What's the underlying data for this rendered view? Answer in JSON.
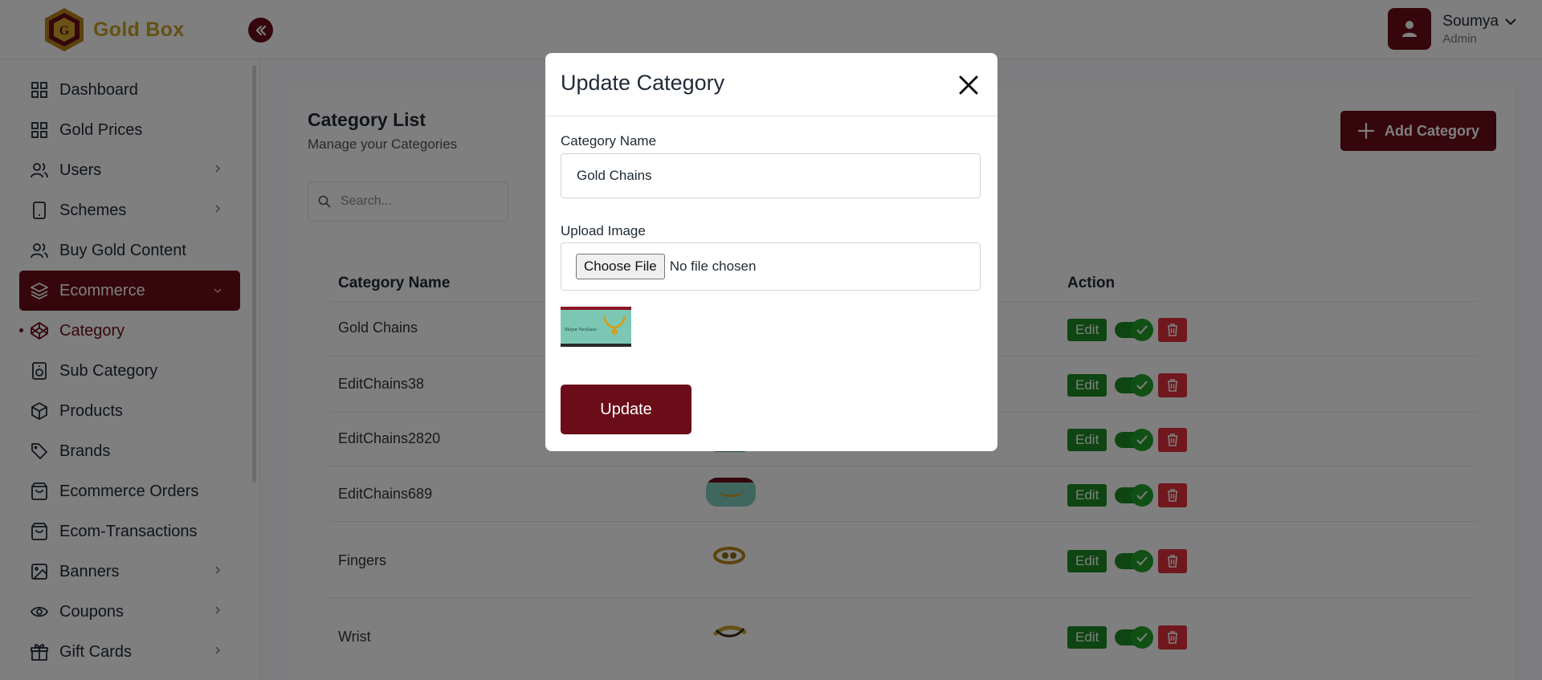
{
  "brand": {
    "name": "Gold Box"
  },
  "user": {
    "name": "Soumya",
    "role": "Admin"
  },
  "sidebar": {
    "items": [
      {
        "label": "Dashboard",
        "icon": "grid-icon"
      },
      {
        "label": "Gold Prices",
        "icon": "grid-icon"
      },
      {
        "label": "Users",
        "icon": "users-icon",
        "has_children": true
      },
      {
        "label": "Schemes",
        "icon": "tablet-icon",
        "has_children": true
      },
      {
        "label": "Buy Gold Content",
        "icon": "users-icon"
      },
      {
        "label": "Ecommerce",
        "icon": "layers-icon",
        "has_children": true,
        "state": "expanded"
      },
      {
        "label": "Category",
        "icon": "codepen-icon",
        "state": "active"
      },
      {
        "label": "Sub Category",
        "icon": "speaker-icon"
      },
      {
        "label": "Products",
        "icon": "box-icon"
      },
      {
        "label": "Brands",
        "icon": "tag-icon"
      },
      {
        "label": "Ecommerce Orders",
        "icon": "shopping-bag-icon"
      },
      {
        "label": "Ecom-Transactions",
        "icon": "shopping-bag-icon"
      },
      {
        "label": "Banners",
        "icon": "image-icon",
        "has_children": true
      },
      {
        "label": "Coupons",
        "icon": "eye-icon",
        "has_children": true
      },
      {
        "label": "Gift Cards",
        "icon": "gift-icon",
        "has_children": true
      }
    ]
  },
  "page": {
    "title": "Category List",
    "subtitle": "Manage your Categories",
    "add_button_label": "Add Category",
    "search_placeholder": "Search..."
  },
  "table": {
    "headers": {
      "name": "Category Name",
      "action": "Action"
    },
    "rows": [
      {
        "name": "Gold Chains",
        "image": "chain-banner"
      },
      {
        "name": "EditChains38",
        "image": "chain-banner"
      },
      {
        "name": "EditChains2820",
        "image": "chain-banner"
      },
      {
        "name": "EditChains689",
        "image": "chain-banner"
      },
      {
        "name": "Fingers",
        "image": "ring"
      },
      {
        "name": "Wrist",
        "image": "bracelet"
      }
    ],
    "edit_label": "Edit"
  },
  "modal": {
    "title": "Update Category",
    "name_label": "Category Name",
    "name_value": "Gold Chains",
    "image_label": "Upload Image",
    "choose_file_label": "Choose File",
    "no_file_text": "No file chosen",
    "preview_caption": "Mayur Necklace",
    "update_label": "Update"
  },
  "colors": {
    "brand": "#6b0d19",
    "gold": "#c9a227",
    "success": "#1f8b24",
    "danger": "#e0313c"
  }
}
